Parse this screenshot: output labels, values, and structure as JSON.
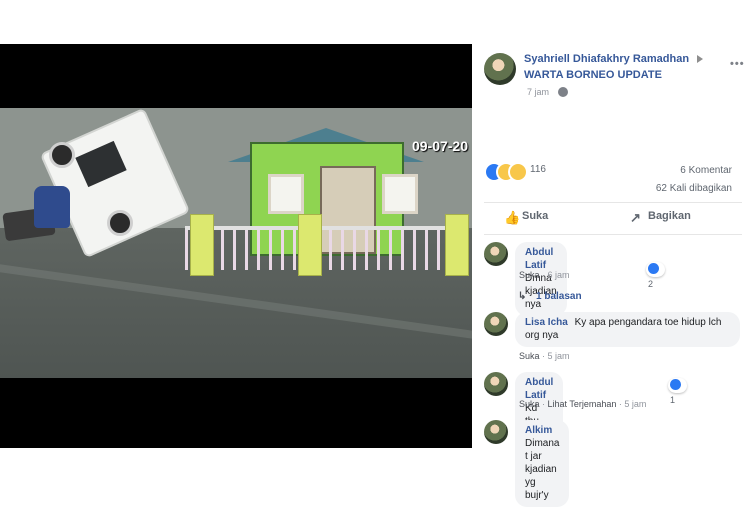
{
  "post": {
    "author_name": "Syahriell Dhiafakhry Ramadhan",
    "page_name": "WARTA BORNEO UPDATE",
    "time": "7 jam",
    "video_timestamp": "09-07-20",
    "reaction_count": "116",
    "comment_count": "6 Komentar",
    "share_count": "62 Kali dibagikan",
    "actions": {
      "like": "Suka",
      "share": "Bagikan"
    },
    "icons": {
      "arrow": "play-arrow-icon",
      "privacy": "globe-icon",
      "more": "more-icon",
      "like": "thumb-icon",
      "share": "share-icon"
    },
    "accent": "#365899"
  },
  "comments": [
    {
      "name": "Abdul Latif",
      "text": "Dmna kjadian nya",
      "meta_action": "Suka",
      "meta_time": "6 jam",
      "reaction_count": "2",
      "reply_label": "1 balasan"
    },
    {
      "name": "Lisa Icha",
      "text": "Ky apa pengandara toe hidup lch org nya",
      "meta_action": "Suka",
      "meta_time": "5 jam"
    },
    {
      "name": "Abdul Latif",
      "text": "Kd thu habar lg nh",
      "meta_action": "Suka",
      "meta_translate": "Lihat Terjemahan",
      "meta_time": "5 jam",
      "reaction_count": "1"
    },
    {
      "name": "Alkim",
      "text": "Dimana t jar kjadian yg bujr'y"
    }
  ]
}
